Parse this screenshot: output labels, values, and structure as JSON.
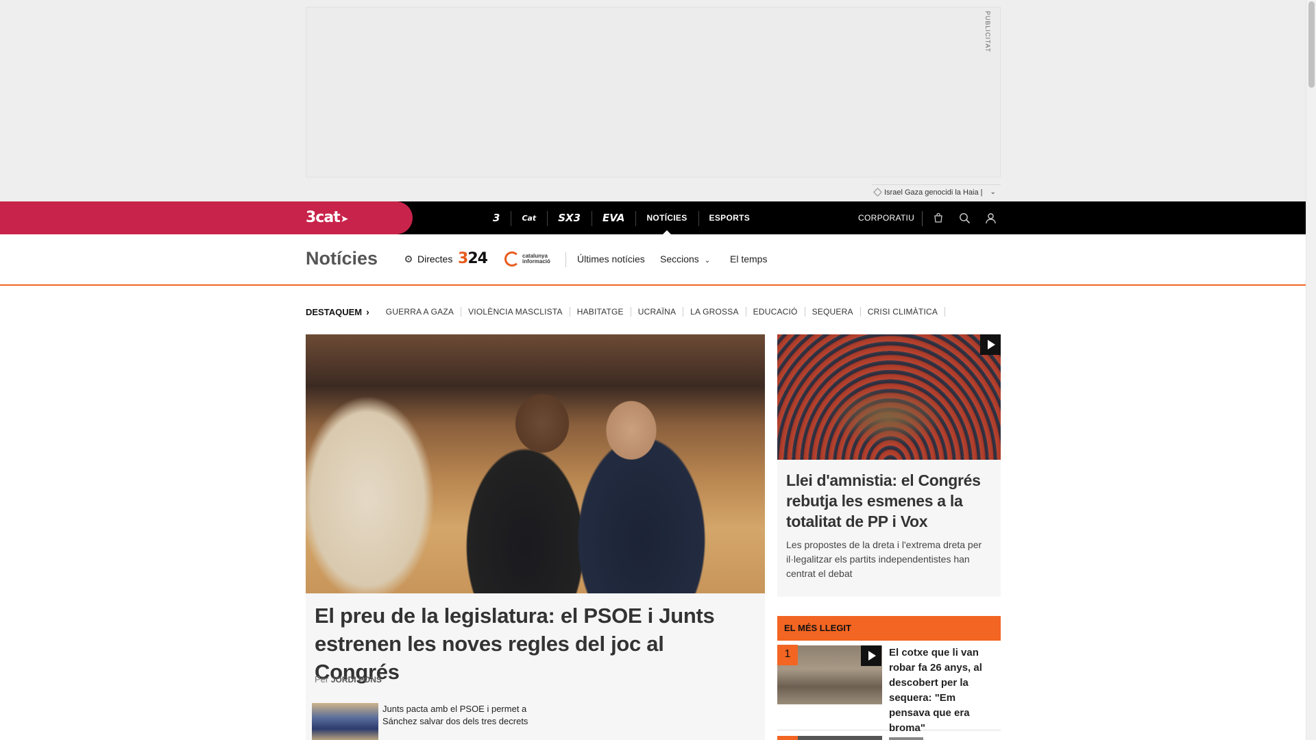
{
  "ad": {
    "label": "PUBLICITAT",
    "trending_text": "Israel Gaza genocidi la Haia |"
  },
  "topnav": {
    "brand": "3cat",
    "channels": [
      {
        "label": "3",
        "kind": "logo",
        "name": "tv3"
      },
      {
        "label": "Cat",
        "kind": "logo",
        "name": "catradio"
      },
      {
        "label": "SX3",
        "kind": "logo",
        "name": "sx3"
      },
      {
        "label": "EVA",
        "kind": "logo",
        "name": "eva"
      },
      {
        "label": "NOTÍCIES",
        "kind": "text",
        "name": "noticies",
        "active": true
      },
      {
        "label": "ESPORTS",
        "kind": "text",
        "name": "esports"
      }
    ],
    "corporatiu": "CORPORATIU",
    "icons": [
      "shopping-bag-icon",
      "search-icon",
      "user-icon"
    ]
  },
  "section": {
    "title": "Notícies",
    "directes": "Directes",
    "logo_324_a": "3",
    "logo_324_b": "24",
    "logo_ci_line1": "catalunya",
    "logo_ci_line2": "informació",
    "links": [
      "Últimes notícies",
      "Seccions",
      "El temps"
    ]
  },
  "destaquem": {
    "label": "DESTAQUEM",
    "topics": [
      "GUERRA A GAZA",
      "VIOLÈNCIA MASCLISTA",
      "HABITATGE",
      "UCRAÏNA",
      "LA GROSSA",
      "EDUCACIÓ",
      "SEQUERA",
      "CRISI CLIMÀTICA"
    ]
  },
  "main_article": {
    "title": "El preu de la legislatura: el PSOE i Junts estrenen les noves regles del joc al Congrés",
    "byline_prefix": "Per",
    "author": "JORDI PONS",
    "related": "Junts pacta amb el PSOE i permet a Sánchez salvar dos dels tres decrets"
  },
  "side_article": {
    "title": "Llei d'amnistia: el Congrés rebutja les esmenes a la totalitat de PP i Vox",
    "description": "Les propostes de la dreta i l'extrema dreta per il·legalitzar els partits independentistes han centrat el debat"
  },
  "most_read": {
    "header": "EL MÉS LLEGIT",
    "items": [
      {
        "rank": "1",
        "title": "El cotxe que li van robar fa 26 anys, al descobert per la sequera: \"Em pensava que era broma\""
      }
    ]
  },
  "colors": {
    "brand_red": "#c8234a",
    "accent_orange": "#f26522",
    "nav_black": "#000000"
  }
}
